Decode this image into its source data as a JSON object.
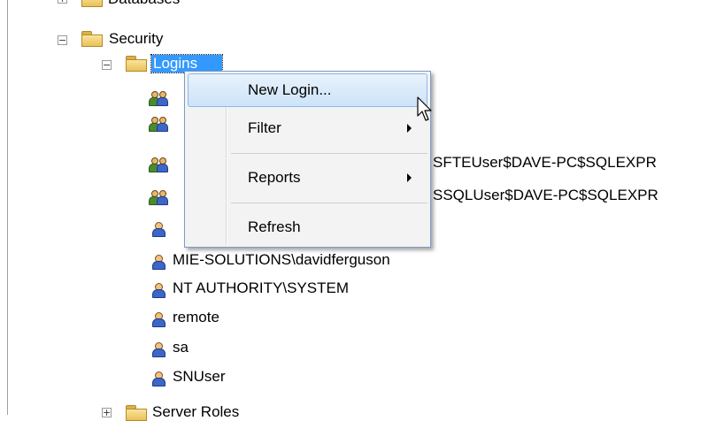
{
  "tree": {
    "top_partial_label": "Databases",
    "security": {
      "label": "Security",
      "expander": "⊟"
    },
    "logins": {
      "label": "Logins",
      "expander": "⊟"
    },
    "hidden_items": [
      {
        "icon": "group-login-icon",
        "label": ""
      },
      {
        "icon": "group-login-icon",
        "label": ""
      },
      {
        "icon": "group-login-icon",
        "label": "SFTEUser$DAVE-PC$SQLEXPR"
      },
      {
        "icon": "group-login-icon",
        "label": "SSQLUser$DAVE-PC$SQLEXPR"
      },
      {
        "icon": "user-login-icon",
        "label": ""
      }
    ],
    "items": [
      {
        "icon": "user-login-icon",
        "label": "MIE-SOLUTIONS\\davidferguson"
      },
      {
        "icon": "user-login-icon",
        "label": "NT AUTHORITY\\SYSTEM"
      },
      {
        "icon": "user-login-icon",
        "label": "remote"
      },
      {
        "icon": "user-login-icon",
        "label": "sa"
      },
      {
        "icon": "user-login-icon",
        "label": "SNUser"
      }
    ],
    "bottom_partial_label": "Server Roles"
  },
  "context_menu": {
    "items": [
      {
        "label": "New Login...",
        "highlighted": true,
        "submenu": false
      },
      {
        "label": "Filter",
        "highlighted": false,
        "submenu": true
      },
      {
        "label": "Reports",
        "highlighted": false,
        "submenu": true
      },
      {
        "label": "Refresh",
        "highlighted": false,
        "submenu": false
      }
    ]
  },
  "colors": {
    "selection": "#3399ff",
    "menu_highlight": "#cde3f8",
    "menu_bg": "#f3f3f3"
  }
}
